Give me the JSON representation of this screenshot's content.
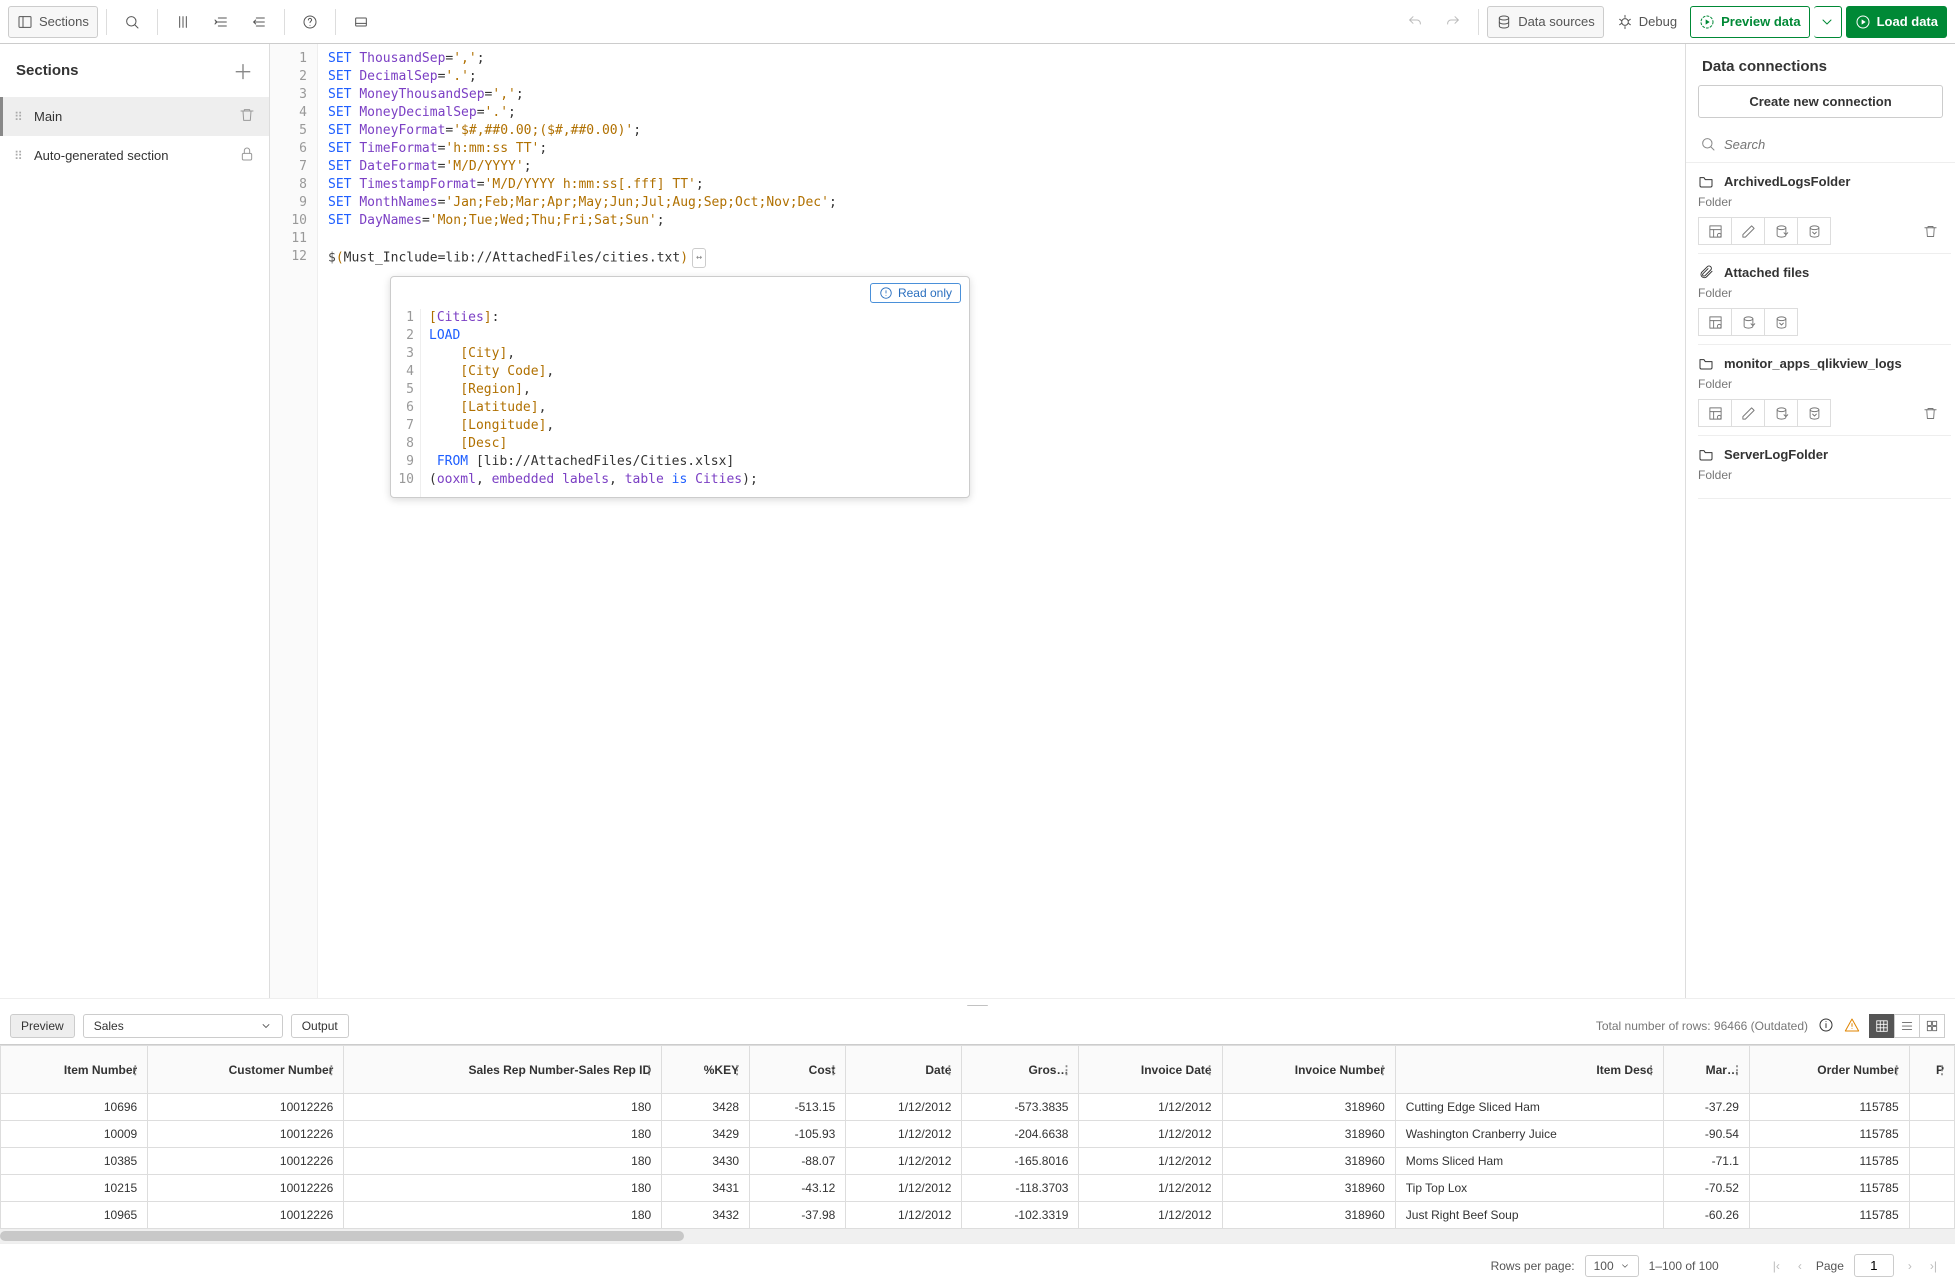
{
  "toolbar": {
    "sections_label": "Sections",
    "data_sources_label": "Data sources",
    "debug_label": "Debug",
    "preview_label": "Preview data",
    "load_label": "Load data"
  },
  "sections": {
    "title": "Sections",
    "items": [
      {
        "label": "Main",
        "active": true,
        "deletable": true
      },
      {
        "label": "Auto-generated section",
        "active": false,
        "locked": true
      }
    ]
  },
  "editor": {
    "lines": [
      {
        "n": 1,
        "t": "SET ThousandSep=',';"
      },
      {
        "n": 2,
        "t": "SET DecimalSep='.';"
      },
      {
        "n": 3,
        "t": "SET MoneyThousandSep=',';"
      },
      {
        "n": 4,
        "t": "SET MoneyDecimalSep='.';"
      },
      {
        "n": 5,
        "t": "SET MoneyFormat='$#,##0.00;($#,##0.00)';"
      },
      {
        "n": 6,
        "t": "SET TimeFormat='h:mm:ss TT';"
      },
      {
        "n": 7,
        "t": "SET DateFormat='M/D/YYYY';"
      },
      {
        "n": 8,
        "t": "SET TimestampFormat='M/D/YYYY h:mm:ss[.fff] TT';"
      },
      {
        "n": 9,
        "t": "SET MonthNames='Jan;Feb;Mar;Apr;May;Jun;Jul;Aug;Sep;Oct;Nov;Dec';"
      },
      {
        "n": 10,
        "t": "SET DayNames='Mon;Tue;Wed;Thu;Fri;Sat;Sun';"
      },
      {
        "n": 11,
        "t": ""
      },
      {
        "n": 12,
        "t": "$(Must_Include=lib://AttachedFiles/cities.txt)"
      }
    ]
  },
  "popup": {
    "readonly_label": "Read only",
    "lines": [
      "[Cities]:",
      "LOAD",
      "    [City],",
      "    [City Code],",
      "    [Region],",
      "    [Latitude],",
      "    [Longitude],",
      "    [Desc]",
      " FROM [lib://AttachedFiles/Cities.xlsx]",
      "(ooxml, embedded labels, table is Cities);"
    ]
  },
  "connections": {
    "title": "Data connections",
    "create_label": "Create new connection",
    "search_placeholder": "Search",
    "items": [
      {
        "name": "ArchivedLogsFolder",
        "type": "Folder",
        "icon": "folder",
        "actions": [
          "select",
          "edit",
          "insert",
          "preview",
          "delete"
        ]
      },
      {
        "name": "Attached files",
        "type": "Folder",
        "icon": "attach",
        "actions": [
          "select",
          "insert",
          "preview"
        ]
      },
      {
        "name": "monitor_apps_qlikview_logs",
        "type": "Folder",
        "icon": "folder",
        "actions": [
          "select",
          "edit",
          "insert",
          "preview",
          "delete"
        ]
      },
      {
        "name": "ServerLogFolder",
        "type": "Folder",
        "icon": "folder",
        "actions": []
      }
    ]
  },
  "preview": {
    "preview_tab": "Preview",
    "table_select": "Sales",
    "output_tab": "Output",
    "total_rows_label": "Total number of rows: 96466 (Outdated)",
    "columns": [
      "Item Number",
      "Customer Number",
      "Sales Rep Number-Sales Rep ID",
      "%KEY",
      "Cost",
      "Date",
      "Gros…",
      "Invoice Date",
      "Invoice Number",
      "Item Desc",
      "Mar…",
      "Order Number",
      "P"
    ],
    "rows": [
      [
        "10696",
        "10012226",
        "180",
        "3428",
        "-513.15",
        "1/12/2012",
        "-573.3835",
        "1/12/2012",
        "318960",
        "Cutting Edge Sliced Ham",
        "-37.29",
        "115785",
        ""
      ],
      [
        "10009",
        "10012226",
        "180",
        "3429",
        "-105.93",
        "1/12/2012",
        "-204.6638",
        "1/12/2012",
        "318960",
        "Washington Cranberry Juice",
        "-90.54",
        "115785",
        ""
      ],
      [
        "10385",
        "10012226",
        "180",
        "3430",
        "-88.07",
        "1/12/2012",
        "-165.8016",
        "1/12/2012",
        "318960",
        "Moms Sliced Ham",
        "-71.1",
        "115785",
        ""
      ],
      [
        "10215",
        "10012226",
        "180",
        "3431",
        "-43.12",
        "1/12/2012",
        "-118.3703",
        "1/12/2012",
        "318960",
        "Tip Top Lox",
        "-70.52",
        "115785",
        ""
      ],
      [
        "10965",
        "10012226",
        "180",
        "3432",
        "-37.98",
        "1/12/2012",
        "-102.3319",
        "1/12/2012",
        "318960",
        "Just Right Beef Soup",
        "-60.26",
        "115785",
        ""
      ]
    ],
    "rows_per_page_label": "Rows per page:",
    "rows_per_page_value": "100",
    "range_label": "1–100 of 100",
    "page_label": "Page",
    "page_value": "1"
  }
}
